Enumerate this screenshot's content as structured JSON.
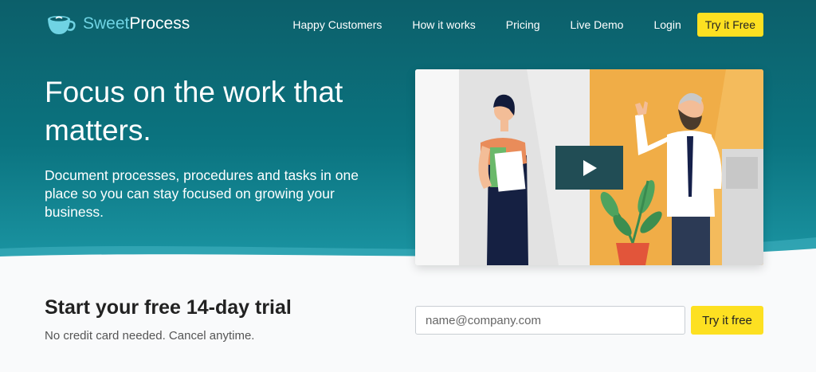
{
  "brand": {
    "name_part1": "Sweet",
    "name_part2": "Process",
    "icon": "coffee-cup-logo-icon"
  },
  "nav": {
    "links": [
      "Happy Customers",
      "How it works",
      "Pricing",
      "Live Demo",
      "Login"
    ],
    "cta_label": "Try it Free"
  },
  "hero": {
    "headline": "Focus on the work that matters.",
    "subtext": "Document processes, procedures and tasks in one place so you can stay focused on growing your business.",
    "video_play_icon": "play-icon"
  },
  "trial": {
    "title": "Start your free 14-day trial",
    "subtitle": "No credit card needed. Cancel anytime.",
    "email_placeholder": "name@company.com",
    "button_label": "Try it free"
  },
  "colors": {
    "hero_bg": "#0b6b76",
    "accent_yellow": "#fde021",
    "logo_light": "#6fd3e3",
    "play_button": "#214d55"
  }
}
